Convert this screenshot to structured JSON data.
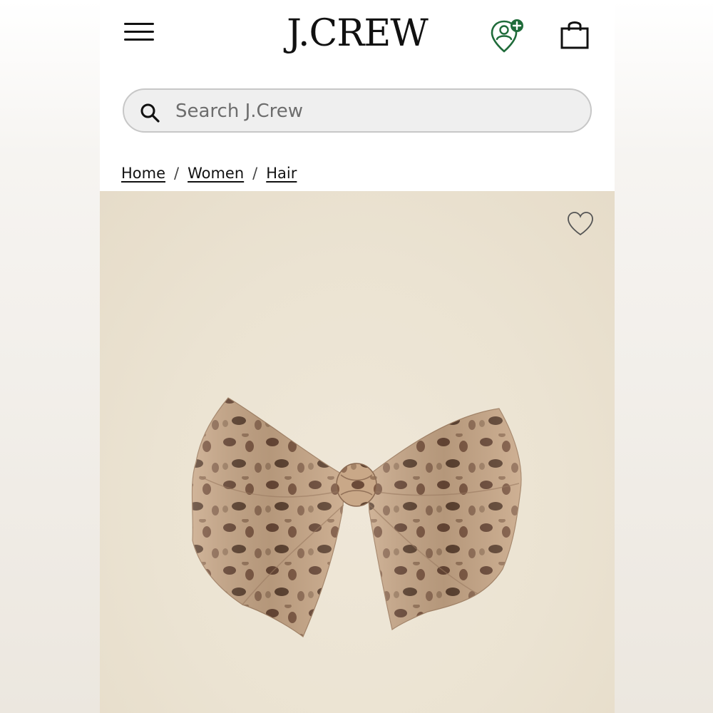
{
  "header": {
    "logo": "J.CREW",
    "menu_icon": "hamburger-menu-icon",
    "account_icon": "account-rewards-icon",
    "bag_icon": "shopping-bag-icon",
    "accent_color": "#1f6b3a"
  },
  "search": {
    "placeholder": "Search J.Crew",
    "value": ""
  },
  "breadcrumb": {
    "items": [
      "Home",
      "Women",
      "Hair"
    ],
    "separator": "/"
  },
  "product": {
    "image": "leopard-print-hair-bow",
    "wishlist_icon": "heart-icon",
    "background_color": "#ebe3d2"
  }
}
